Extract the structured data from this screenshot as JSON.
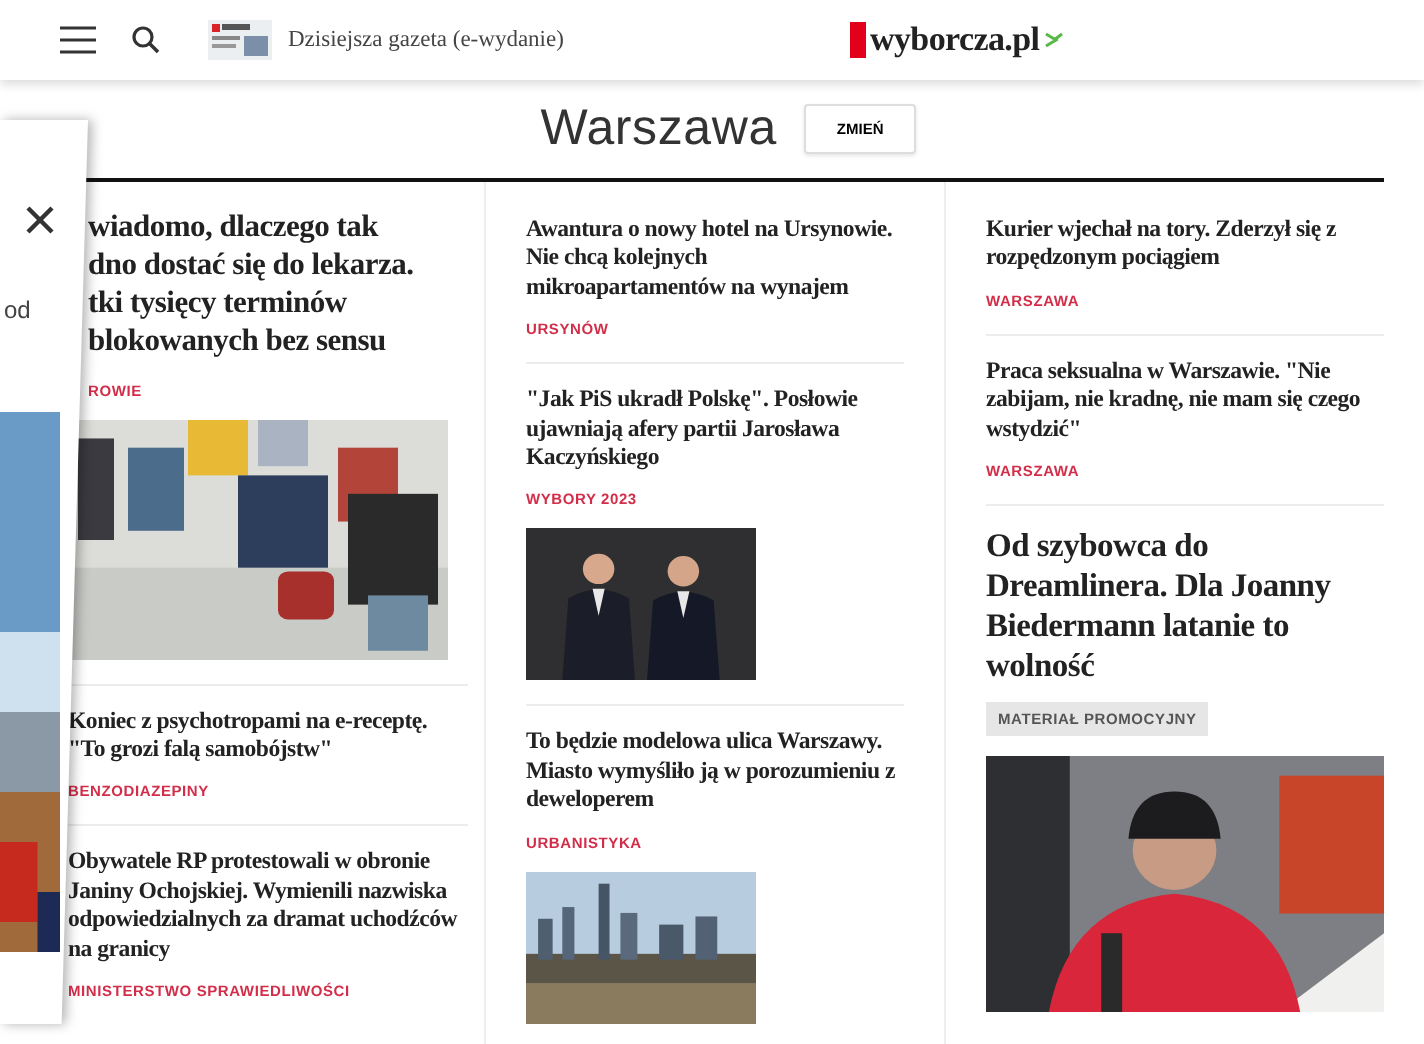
{
  "header": {
    "edition_label": "Dzisiejsza gazeta (e-wydanie)",
    "logo": "wyborcza.pl"
  },
  "section": {
    "title": "Warszawa",
    "change_button": "ZMIEŃ"
  },
  "overlay": {
    "text": "od"
  },
  "columns": [
    {
      "articles": [
        {
          "kind": "lead",
          "headline_lines": [
            "wiadomo, dlaczego tak",
            "dno dostać się do lekarza.",
            "tki tysięcy terminów",
            "blokowanych bez sensu"
          ],
          "category": "ROWIE"
        },
        {
          "kind": "standard",
          "headline": "Koniec z psychotropami na e-receptę. \"To grozi falą samobójstw\"",
          "category": "BENZODIAZEPINY"
        },
        {
          "kind": "standard",
          "headline": "Obywatele RP protestowali w obronie Janiny Ochojskiej. Wymienili nazwiska odpowiedzialnych za dramat uchodźców na granicy",
          "category": "MINISTERSTWO SPRAWIEDLIWOŚCI"
        }
      ]
    },
    {
      "articles": [
        {
          "kind": "standard",
          "headline": "Awantura o nowy hotel na Ursynowie. Nie chcą kolejnych mikroapartamentów na wynajem",
          "category": "URSYNÓW"
        },
        {
          "kind": "standard",
          "headline": "\"Jak PiS ukradł Polskę\". Posłowie ujawniają afery partii Jarosława Kaczyńskiego",
          "category": "WYBORY 2023"
        },
        {
          "kind": "standard",
          "headline": "To będzie modelowa ulica Warszawy. Miasto wymyśliło ją w porozumieniu z deweloperem",
          "category": "URBANISTYKA"
        }
      ]
    },
    {
      "articles": [
        {
          "kind": "standard",
          "headline": "Kurier wjechał na tory. Zderzył się z rozpędzonym pociągiem",
          "category": "WARSZAWA"
        },
        {
          "kind": "standard",
          "headline": "Praca seksualna w Warszawie. \"Nie zabijam, nie kradnę, nie mam się czego wstydzić\"",
          "category": "WARSZAWA"
        },
        {
          "kind": "promo",
          "headline": "Od szybowca do Dreamlinera. Dla Joanny Biedermann latanie to wolność",
          "category": "MATERIAŁ PROMOCYJNY"
        }
      ]
    }
  ]
}
